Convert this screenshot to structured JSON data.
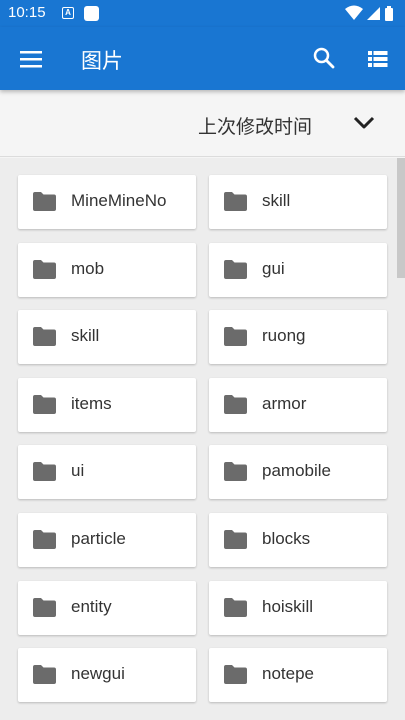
{
  "status_bar": {
    "time": "10:15",
    "notification_icon": "A",
    "icons": [
      "wifi-icon",
      "signal-icon",
      "battery-icon"
    ]
  },
  "app_bar": {
    "title": "图片",
    "menu_icon": "menu-icon",
    "search_icon": "search-icon",
    "view_icon": "list-view-icon",
    "color": "#1976d2"
  },
  "sort": {
    "label": "上次修改时间",
    "icon": "chevron-down-icon"
  },
  "folders": [
    {
      "name": "MineMineNo"
    },
    {
      "name": "skill"
    },
    {
      "name": "mob"
    },
    {
      "name": "gui"
    },
    {
      "name": "skill"
    },
    {
      "name": "ruong"
    },
    {
      "name": "items"
    },
    {
      "name": "armor"
    },
    {
      "name": "ui"
    },
    {
      "name": "pamobile"
    },
    {
      "name": "particle"
    },
    {
      "name": "blocks"
    },
    {
      "name": "entity"
    },
    {
      "name": "hoiskill"
    },
    {
      "name": "newgui"
    },
    {
      "name": "notepe"
    }
  ]
}
